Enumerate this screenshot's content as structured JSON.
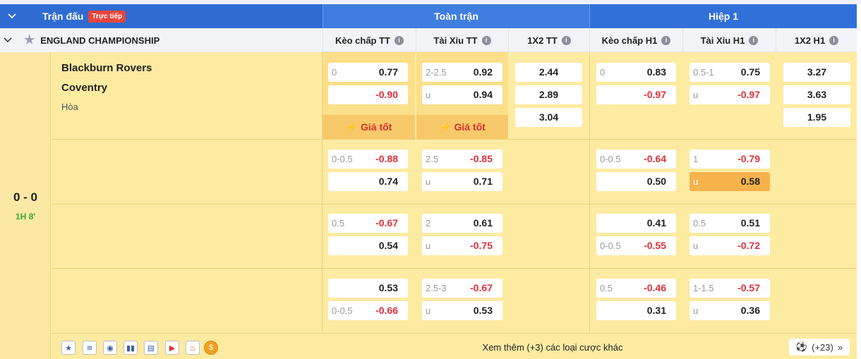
{
  "header": {
    "match_label": "Trận đấu",
    "live_badge": "Trực tiếp",
    "full_time": "Toàn trận",
    "half": "Hiệp 1"
  },
  "columns": {
    "league": "ENGLAND CHAMPIONSHIP",
    "hdp_ft": "Kèo chấp TT",
    "ou_ft": "Tài Xỉu TT",
    "x12_ft": "1X2 TT",
    "hdp_h1": "Kèo chấp H1",
    "ou_h1": "Tài Xỉu H1",
    "x12_h1": "1X2 H1"
  },
  "match": {
    "home": "Blackburn Rovers",
    "away": "Coventry",
    "draw": "Hòa",
    "score": "0 - 0",
    "minute": "1H 8'"
  },
  "best_price": "Giá tốt",
  "rows": [
    {
      "hdp_ft": [
        {
          "h": "0",
          "v": "0.77"
        },
        {
          "h": "",
          "v": "-0.90"
        }
      ],
      "ou_ft": [
        {
          "h": "2-2.5",
          "v": "0.92"
        },
        {
          "h": "u",
          "v": "0.94"
        }
      ],
      "x12_ft": [
        "2.44",
        "2.89",
        "3.04"
      ],
      "hdp_h1": [
        {
          "h": "0",
          "v": "0.83"
        },
        {
          "h": "",
          "v": "-0.97"
        }
      ],
      "ou_h1": [
        {
          "h": "0.5-1",
          "v": "0.75"
        },
        {
          "h": "u",
          "v": "-0.97"
        }
      ],
      "x12_h1": [
        "3.27",
        "3.63",
        "1.95"
      ]
    },
    {
      "hdp_ft": [
        {
          "h": "0-0.5",
          "v": "-0.88"
        },
        {
          "h": "",
          "v": "0.74"
        }
      ],
      "ou_ft": [
        {
          "h": "2.5",
          "v": "-0.85"
        },
        {
          "h": "u",
          "v": "0.71"
        }
      ],
      "hdp_h1": [
        {
          "h": "0-0.5",
          "v": "-0.64"
        },
        {
          "h": "",
          "v": "0.50"
        }
      ],
      "ou_h1": [
        {
          "h": "1",
          "v": "-0.79"
        },
        {
          "h": "u",
          "v": "0.58"
        }
      ]
    },
    {
      "hdp_ft": [
        {
          "h": "0.5",
          "v": "-0.67"
        },
        {
          "h": "",
          "v": "0.54"
        }
      ],
      "ou_ft": [
        {
          "h": "2",
          "v": "0.61"
        },
        {
          "h": "u",
          "v": "-0.75"
        }
      ],
      "hdp_h1": [
        {
          "h": "",
          "v": "0.41"
        },
        {
          "h": "0-0.5",
          "v": "-0.55"
        }
      ],
      "ou_h1": [
        {
          "h": "0.5",
          "v": "0.51"
        },
        {
          "h": "u",
          "v": "-0.72"
        }
      ]
    },
    {
      "hdp_ft": [
        {
          "h": "",
          "v": "0.53"
        },
        {
          "h": "0-0.5",
          "v": "-0.66"
        }
      ],
      "ou_ft": [
        {
          "h": "2.5-3",
          "v": "-0.67"
        },
        {
          "h": "u",
          "v": "0.53"
        }
      ],
      "hdp_h1": [
        {
          "h": "0.5",
          "v": "-0.46"
        },
        {
          "h": "",
          "v": "0.31"
        }
      ],
      "ou_h1": [
        {
          "h": "1-1.5",
          "v": "-0.57"
        },
        {
          "h": "u",
          "v": "0.36"
        }
      ]
    }
  ],
  "footer": {
    "more_text": "Xem thêm (+3) các loại cược khác",
    "count": "(+23)",
    "icons": [
      "star-icon",
      "database-icon",
      "eye-icon",
      "stats-icon",
      "lineup-icon",
      "play-icon",
      "fire-icon",
      "money-icon"
    ]
  },
  "colors": {
    "header_blue": "#2f6cd2",
    "row_yellow": "#fdeba2",
    "negative": "#e0303a",
    "highlight_orange": "#f6b24b",
    "live_green": "#3aa83a"
  }
}
